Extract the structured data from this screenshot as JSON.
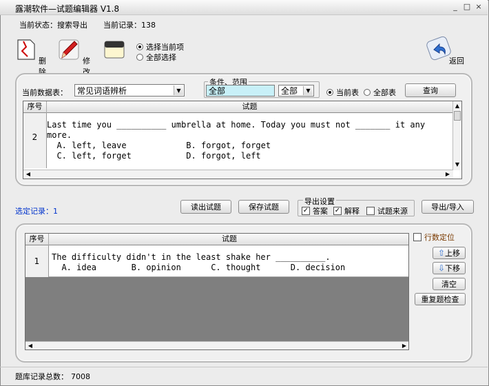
{
  "window": {
    "title": "露潮软件—试题编辑器 V1.8",
    "minimize": "_",
    "maximize": "□",
    "close": "×"
  },
  "status": {
    "state_label": "当前状态：",
    "state_value": "搜索导出",
    "record_label": "当前记录：",
    "record_value": "138"
  },
  "toolbar": {
    "delete_label": "删除",
    "edit_label": "修改",
    "select_current": "选择当前项",
    "select_all": "全部选择",
    "return_label": "返回"
  },
  "search": {
    "db_label": "当前数据表：",
    "db_value": "常见词语辨析",
    "condition_legend": "条件、范围",
    "condition_value": "全部",
    "range_value": "全部",
    "scope_current": "当前表",
    "scope_all": "全部表",
    "query_button": "查询"
  },
  "top_grid": {
    "col_num": "序号",
    "col_question": "试题",
    "rows": [
      {
        "num": "2",
        "line1": "Last time you __________ umbrella at home. Today you must not _______ it any",
        "line2": "more.",
        "line3": "  A. left, leave            B. forgot, forget",
        "line4": "  C. left, forget           D. forgot, left"
      }
    ]
  },
  "middle": {
    "selected_label": "选定记录：1",
    "read_button": "读出试题",
    "save_button": "保存试题",
    "export_legend": "导出设置",
    "opt_answer": "答案",
    "opt_explain": "解释",
    "opt_source": "试题来源",
    "export_import_button": "导出/导入"
  },
  "bottom_grid": {
    "col_num": "序号",
    "col_question": "试题",
    "rows": [
      {
        "num": "1",
        "line1": "The difficulty didn't in the least shake her __________.",
        "line2": "  A. idea       B. opinion      C. thought      D. decision"
      }
    ]
  },
  "side": {
    "locate_label": "行数定位",
    "up_button": "上移",
    "down_button": "下移",
    "clear_button": "清空",
    "dup_button": "重复题检查"
  },
  "footer": {
    "total_label": "题库记录总数：",
    "total_value": "7008"
  },
  "colors": {
    "field_bg": "#c8f0f8",
    "selected_label_color": "#0033cc",
    "gray_fill": "#7f7f7f"
  }
}
